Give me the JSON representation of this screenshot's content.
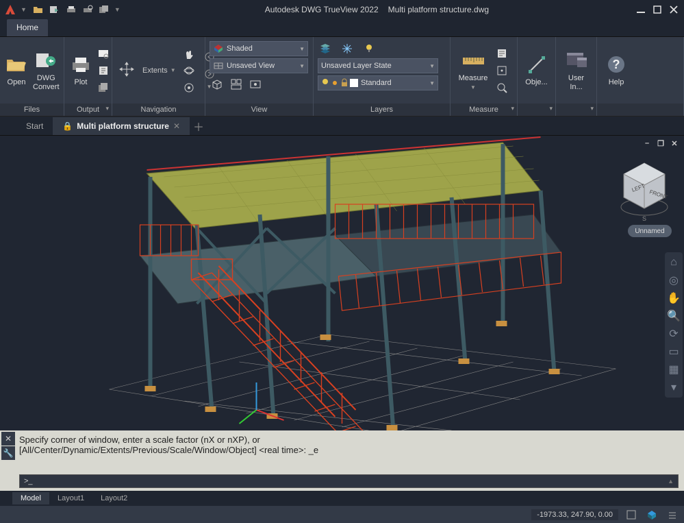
{
  "title": {
    "app": "Autodesk DWG TrueView 2022",
    "file": "Multi platform structure.dwg"
  },
  "ribbon_tab": "Home",
  "ribbon": {
    "files": {
      "title": "Files",
      "open": "Open",
      "convert_l1": "DWG",
      "convert_l2": "Convert"
    },
    "output": {
      "title": "Output",
      "plot": "Plot"
    },
    "nav": {
      "title": "Navigation",
      "extents": "Extents"
    },
    "view": {
      "title": "View",
      "visual": "Shaded",
      "saved_view": "Unsaved View"
    },
    "layers": {
      "title": "Layers",
      "state": "Unsaved Layer State",
      "current": "Standard"
    },
    "measure": {
      "title": "Measure",
      "measure": "Measure"
    },
    "obj": {
      "label": "Obje..."
    },
    "ui": {
      "label": "User In..."
    },
    "help": {
      "label": "Help"
    }
  },
  "doc_tabs": {
    "start": "Start",
    "active": "Multi platform structure"
  },
  "viewcube": {
    "left": "LEFT",
    "front": "FRONT",
    "view_name": "Unnamed"
  },
  "command": {
    "line1": "Specify corner of window, enter a scale factor (nX or nXP), or",
    "line2": "[All/Center/Dynamic/Extents/Previous/Scale/Window/Object] <real time>: _e",
    "prompt_icon": ">_"
  },
  "layout_tabs": [
    "Model",
    "Layout1",
    "Layout2"
  ],
  "status": {
    "coords": "-1973.33, 247.90, 0.00"
  }
}
